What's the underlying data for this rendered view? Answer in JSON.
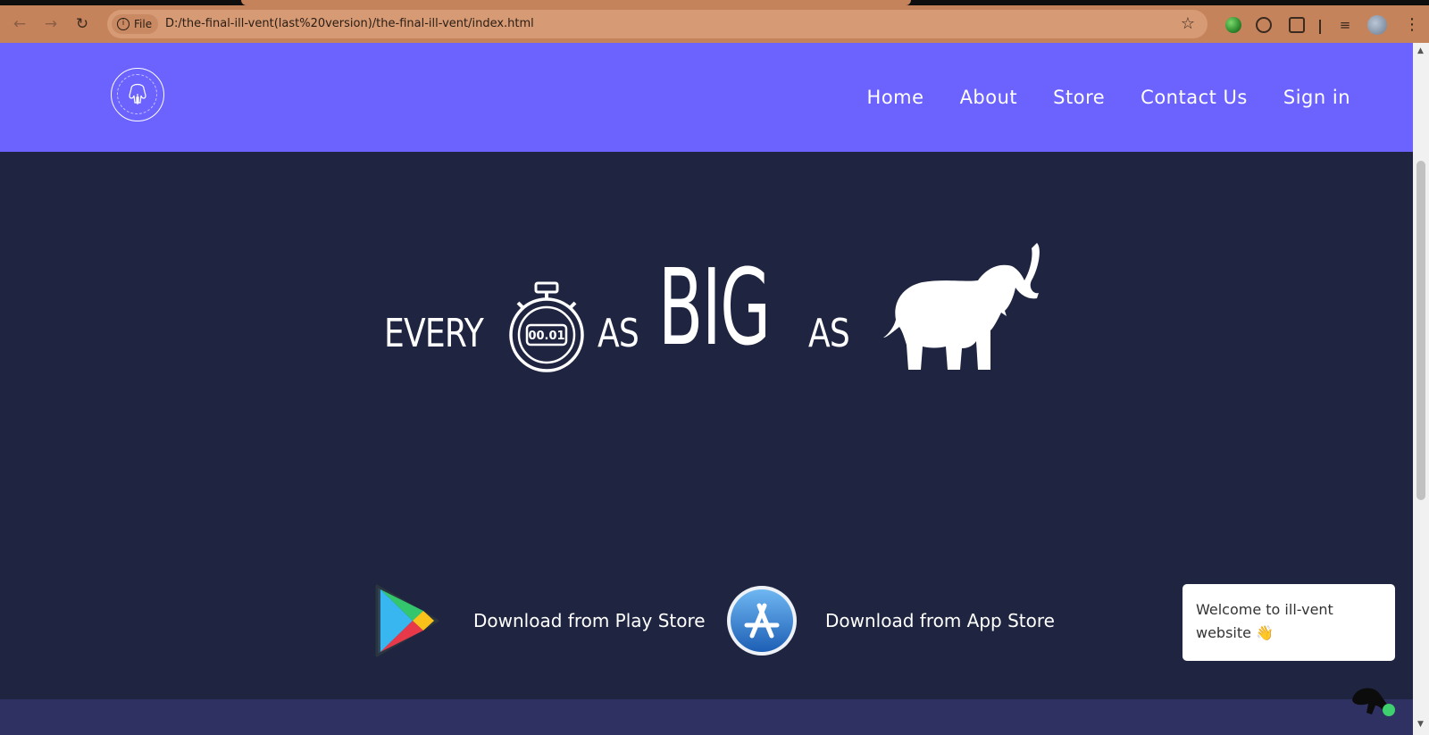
{
  "browser": {
    "url": "D:/the-final-ill-vent(last%20version)/the-final-ill-vent/index.html",
    "site_chip": "File",
    "back_icon": "arrow-left-icon",
    "forward_icon": "arrow-right-icon",
    "reload_icon": "reload-icon",
    "colors": {
      "toolbar": "#c5835c",
      "omnibox": "#d69a74"
    }
  },
  "site": {
    "colors": {
      "navbar": "#6c63ff",
      "background": "#1f2540",
      "band": "#2f3163",
      "text": "#ffffff"
    },
    "nav": {
      "logo_icon": "elephant-logo-icon",
      "links": [
        "Home",
        "About",
        "Store",
        "Contact Us",
        "Sign in"
      ]
    },
    "hero": {
      "word1": "EVERY",
      "stopwatch_label": "00.01",
      "word2": "AS",
      "word3": "BIG",
      "word4": "AS"
    },
    "downloads": {
      "play_label": "Download from Play Store",
      "app_label": "Download from App Store"
    },
    "chat": {
      "welcome": "Welcome to ill-vent website 👋",
      "status_color": "#3ecf6e"
    }
  }
}
